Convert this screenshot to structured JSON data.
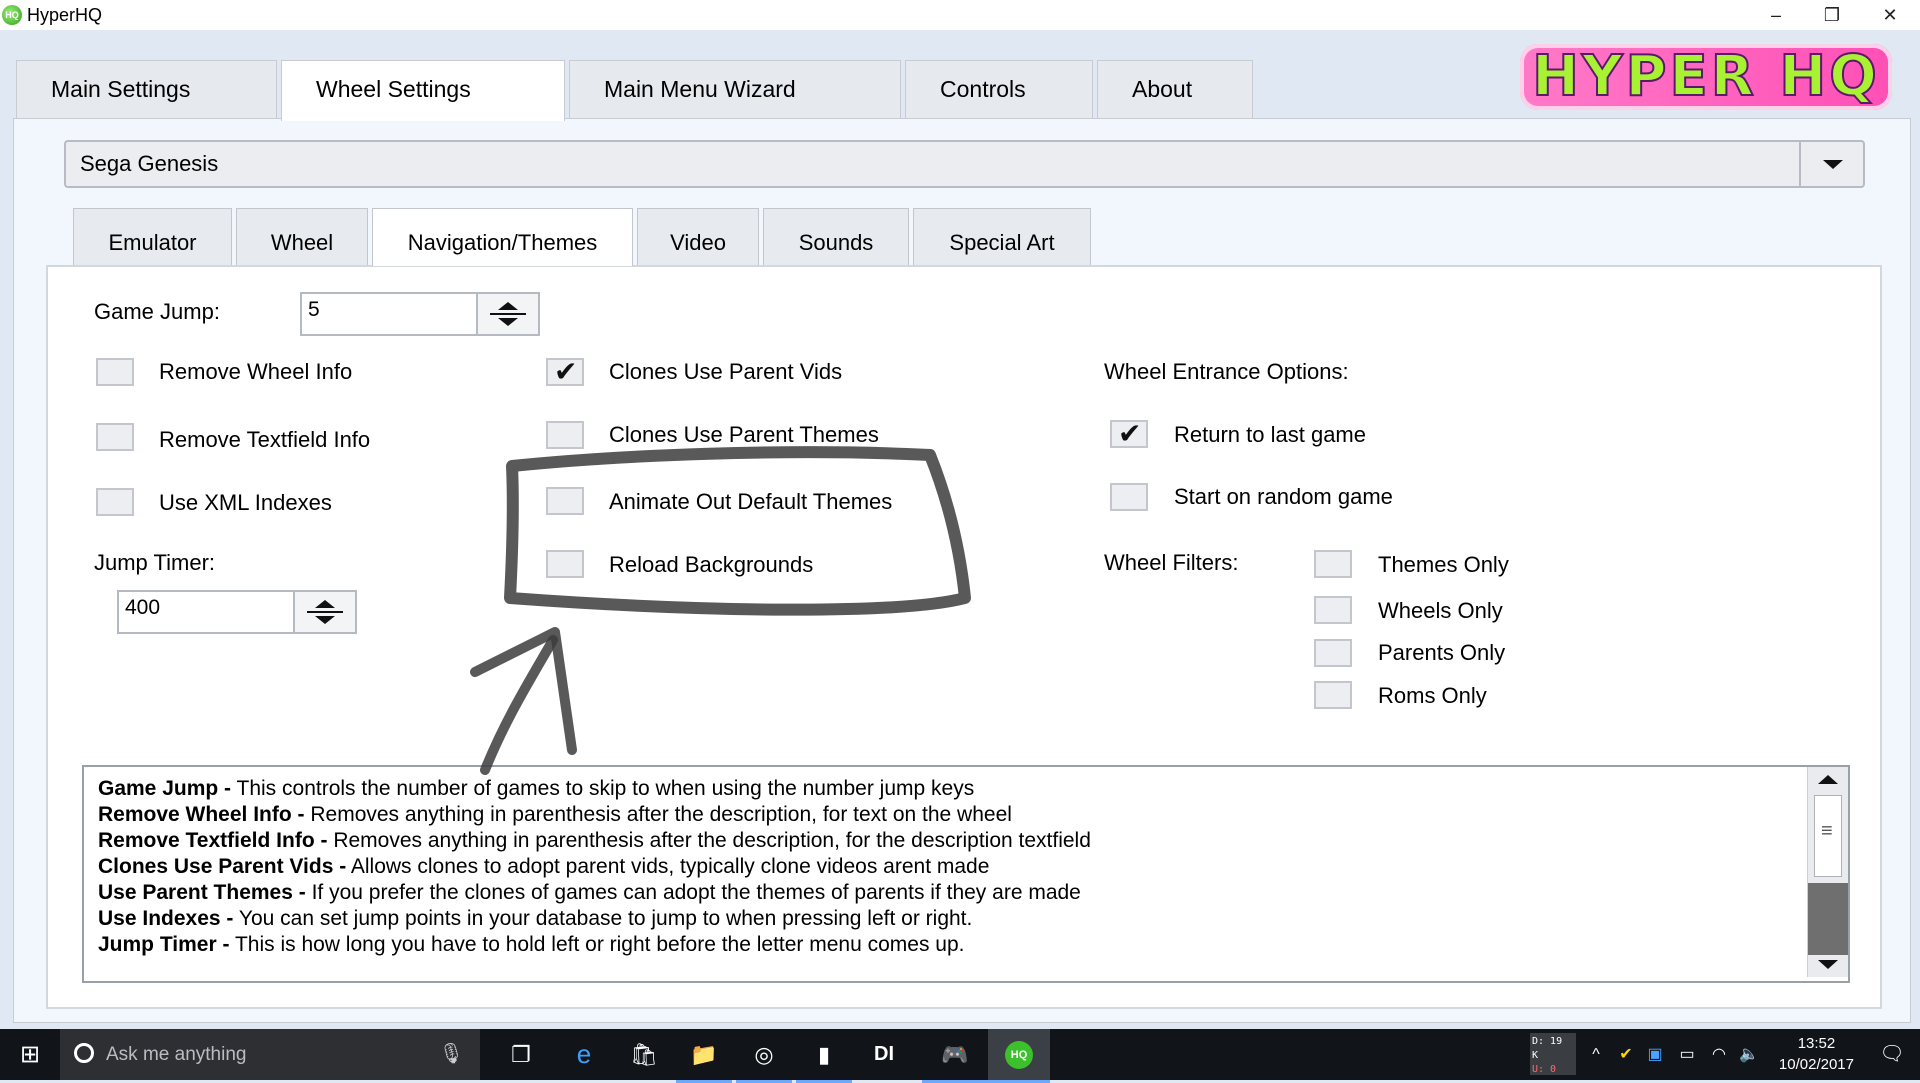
{
  "window": {
    "title": "HyperHQ",
    "app_icon_text": "HQ",
    "controls": [
      "–",
      "❐",
      "✕"
    ]
  },
  "logo": {
    "text": "HYPER HQ"
  },
  "main_tabs": [
    "Main Settings",
    "Wheel Settings",
    "Main Menu Wizard",
    "Controls",
    "About"
  ],
  "system_select": {
    "value": "Sega Genesis"
  },
  "sub_tabs": [
    "Emulator",
    "Wheel",
    "Navigation/Themes",
    "Video",
    "Sounds",
    "Special Art"
  ],
  "form": {
    "game_jump_label": "Game Jump:",
    "game_jump_value": "5",
    "jump_timer_label": "Jump Timer:",
    "jump_timer_value": "400",
    "col1": [
      {
        "label": "Remove Wheel Info",
        "checked": false
      },
      {
        "label": "Remove Textfield Info",
        "checked": false
      },
      {
        "label": "Use XML Indexes",
        "checked": false
      }
    ],
    "col2": [
      {
        "label": "Clones Use Parent Vids",
        "checked": true
      },
      {
        "label": "Clones Use Parent Themes",
        "checked": false
      },
      {
        "label": "Animate Out Default Themes",
        "checked": false
      },
      {
        "label": "Reload Backgrounds",
        "checked": false
      }
    ],
    "entrance_label": "Wheel Entrance Options:",
    "entrance": [
      {
        "label": "Return to last game",
        "checked": true
      },
      {
        "label": "Start on random game",
        "checked": false
      }
    ],
    "filters_label": "Wheel Filters:",
    "filters": [
      {
        "label": "Themes Only",
        "checked": false
      },
      {
        "label": "Wheels Only",
        "checked": false
      },
      {
        "label": "Parents Only",
        "checked": false
      },
      {
        "label": "Roms Only",
        "checked": false
      }
    ]
  },
  "help": [
    {
      "term": "Game Jump -",
      "text": " This controls the number of games to skip to when using the number jump keys"
    },
    {
      "term": "Remove Wheel Info -",
      "text": " Removes anything in parenthesis after the description, for text on the wheel"
    },
    {
      "term": "Remove Textfield Info -",
      "text": " Removes anything in parenthesis after the description, for the description textfield"
    },
    {
      "term": "Clones Use Parent Vids -",
      "text": " Allows clones to adopt parent vids, typically clone videos arent made"
    },
    {
      "term": "Use Parent Themes -",
      "text": " If you prefer the clones of games can adopt the themes of parents if they are made"
    },
    {
      "term": "Use Indexes -",
      "text": " You can set jump points in your database to jump to when pressing left or right."
    },
    {
      "term": "Jump Timer -",
      "text": " This is how long you have to hold left or right before the letter menu comes up."
    }
  ],
  "taskbar": {
    "search_placeholder": "Ask me anything",
    "netmon": {
      "down": "D: 19 K",
      "up": "U: 0"
    },
    "time": "13:52",
    "date": "10/02/2017"
  },
  "colors": {
    "accent": "#ff4fb6",
    "logo_text": "#a9f233",
    "annotation": "#3c3c3c"
  }
}
